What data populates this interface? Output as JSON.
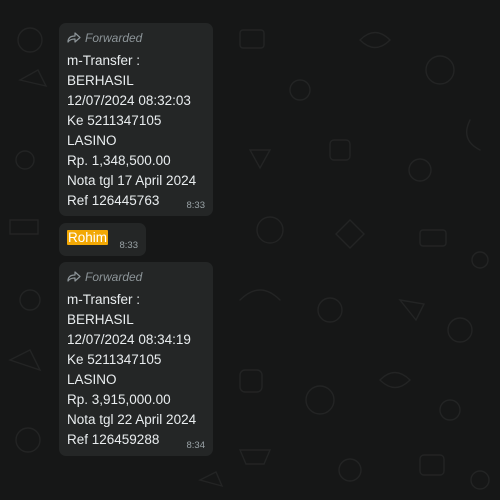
{
  "messages": [
    {
      "forwarded_label": "Forwarded",
      "lines": [
        "m-Transfer :",
        "BERHASIL",
        "12/07/2024 08:32:03",
        "Ke 5211347105",
        "LASINO",
        "Rp. 1,348,500.00",
        "Nota tgl 17 April 2024",
        "Ref 126445763"
      ],
      "time": "8:33"
    },
    {
      "text": "Rohim",
      "time": "8:33"
    },
    {
      "forwarded_label": "Forwarded",
      "lines": [
        "m-Transfer :",
        "BERHASIL",
        "12/07/2024 08:34:19",
        "Ke 5211347105",
        "LASINO",
        "Rp. 3,915,000.00",
        "Nota tgl 22 April 2024",
        "Ref 126459288"
      ],
      "time": "8:34"
    }
  ],
  "colors": {
    "background": "#161717",
    "bubble": "#242626",
    "text": "#e9edef",
    "meta": "#8d9599",
    "highlight": "#f2a804"
  },
  "icons": {
    "forwarded": "forward-arrow-icon"
  }
}
